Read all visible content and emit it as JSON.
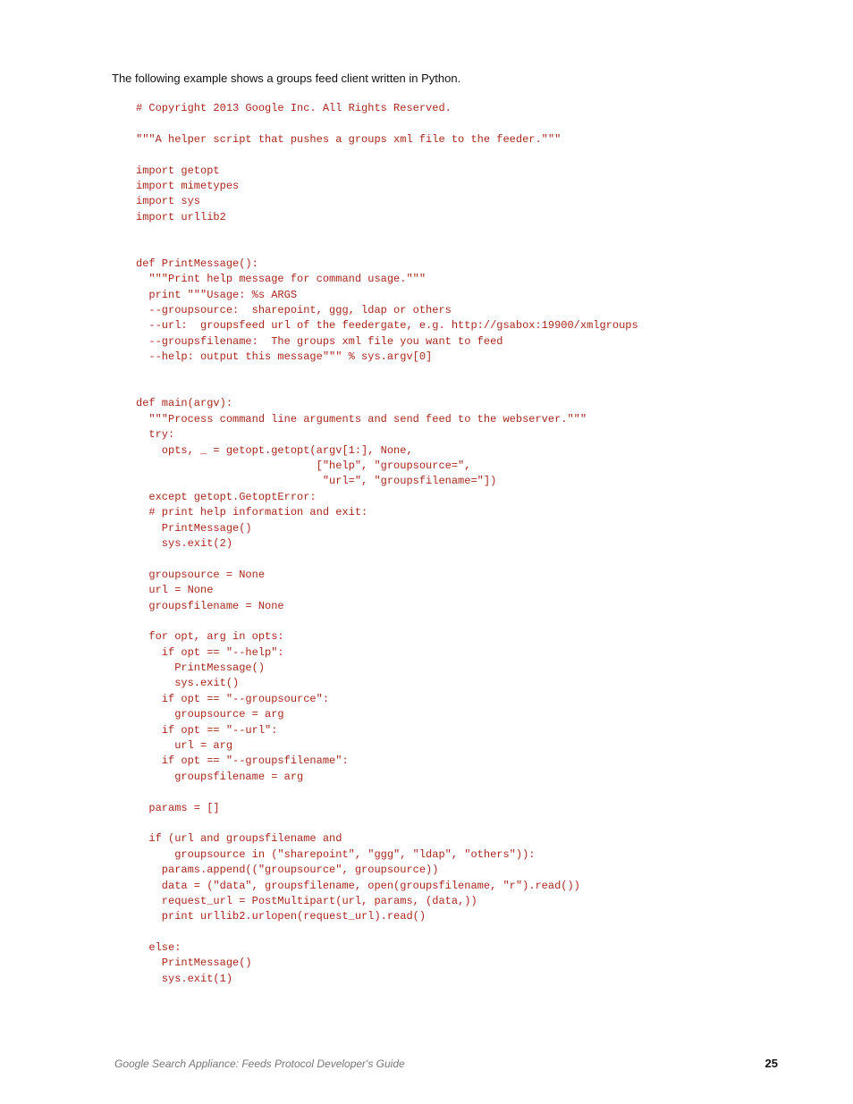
{
  "intro": "The following example shows a groups feed client written in Python.",
  "code": "# Copyright 2013 Google Inc. All Rights Reserved.\n\n\"\"\"A helper script that pushes a groups xml file to the feeder.\"\"\"\n\nimport getopt\nimport mimetypes\nimport sys\nimport urllib2\n\n\ndef PrintMessage():\n  \"\"\"Print help message for command usage.\"\"\"\n  print \"\"\"Usage: %s ARGS\n  --groupsource:  sharepoint, ggg, ldap or others\n  --url:  groupsfeed url of the feedergate, e.g. http://gsabox:19900/xmlgroups\n  --groupsfilename:  The groups xml file you want to feed\n  --help: output this message\"\"\" % sys.argv[0]\n\n\ndef main(argv):\n  \"\"\"Process command line arguments and send feed to the webserver.\"\"\"\n  try:\n    opts, _ = getopt.getopt(argv[1:], None,\n                            [\"help\", \"groupsource=\",\n                             \"url=\", \"groupsfilename=\"])\n  except getopt.GetoptError:\n  # print help information and exit:\n    PrintMessage()\n    sys.exit(2)\n\n  groupsource = None\n  url = None\n  groupsfilename = None\n\n  for opt, arg in opts:\n    if opt == \"--help\":\n      PrintMessage()\n      sys.exit()\n    if opt == \"--groupsource\":\n      groupsource = arg\n    if opt == \"--url\":\n      url = arg\n    if opt == \"--groupsfilename\":\n      groupsfilename = arg\n\n  params = []\n\n  if (url and groupsfilename and\n      groupsource in (\"sharepoint\", \"ggg\", \"ldap\", \"others\")):\n    params.append((\"groupsource\", groupsource))\n    data = (\"data\", groupsfilename, open(groupsfilename, \"r\").read())\n    request_url = PostMultipart(url, params, (data,))\n    print urllib2.urlopen(request_url).read()\n\n  else:\n    PrintMessage()\n    sys.exit(1)",
  "footer": {
    "title": "Google Search Appliance: Feeds Protocol Developer's Guide",
    "page": "25"
  }
}
